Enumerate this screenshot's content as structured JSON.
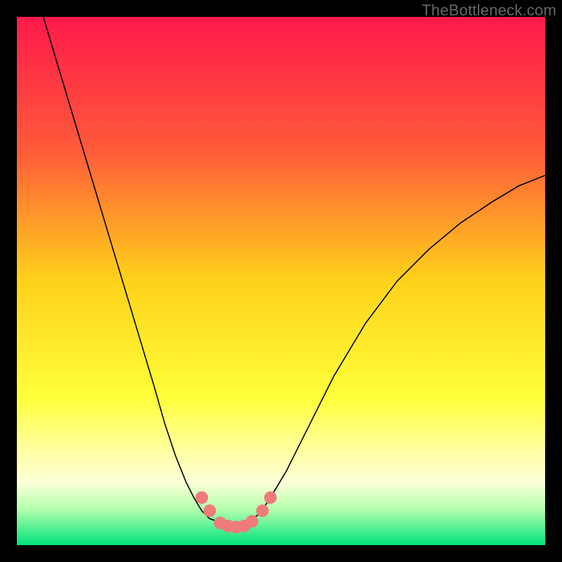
{
  "watermark": "TheBottleneck.com",
  "chart_data": {
    "type": "line",
    "title": "",
    "xlabel": "",
    "ylabel": "",
    "xlim": [
      0,
      100
    ],
    "ylim": [
      0,
      100
    ],
    "grid": false,
    "legend": false,
    "background_gradient": {
      "stops": [
        {
          "offset": 0.0,
          "color": "#ff1a4b"
        },
        {
          "offset": 0.25,
          "color": "#ff5a3a"
        },
        {
          "offset": 0.5,
          "color": "#ffd21a"
        },
        {
          "offset": 0.72,
          "color": "#ffff3a"
        },
        {
          "offset": 0.82,
          "color": "#ffffa0"
        },
        {
          "offset": 0.88,
          "color": "#fcffd6"
        },
        {
          "offset": 0.93,
          "color": "#b8ffb0"
        },
        {
          "offset": 1.0,
          "color": "#00e37a"
        }
      ]
    },
    "series": [
      {
        "name": "left-curve",
        "color": "#000000",
        "width": 1.6,
        "x": [
          5,
          8,
          11,
          14,
          17,
          20,
          23,
          26,
          28,
          30,
          32,
          33.5,
          35,
          36.5,
          38
        ],
        "y": [
          100,
          90,
          80,
          70,
          60,
          50,
          40,
          30,
          23,
          17,
          12,
          9,
          6.5,
          5,
          4.5
        ]
      },
      {
        "name": "right-curve",
        "color": "#000000",
        "width": 1.6,
        "x": [
          44,
          46,
          48,
          51,
          55,
          60,
          66,
          72,
          78,
          84,
          90,
          95,
          100
        ],
        "y": [
          4.5,
          6,
          9,
          14,
          22,
          32,
          42,
          50,
          56,
          61,
          65,
          68,
          70
        ]
      },
      {
        "name": "valley-floor",
        "color": "#000000",
        "width": 1.6,
        "x": [
          38,
          40,
          41,
          42,
          43,
          44
        ],
        "y": [
          4.5,
          3.6,
          3.4,
          3.4,
          3.6,
          4.5
        ]
      }
    ],
    "markers": {
      "name": "valley-markers",
      "color": "#ef7b7b",
      "radius": 9,
      "x": [
        35,
        36.5,
        38.5,
        40,
        41.5,
        43,
        44.5,
        46.5,
        48
      ],
      "y": [
        9,
        6.5,
        4.2,
        3.6,
        3.4,
        3.6,
        4.5,
        6.5,
        9
      ]
    }
  }
}
